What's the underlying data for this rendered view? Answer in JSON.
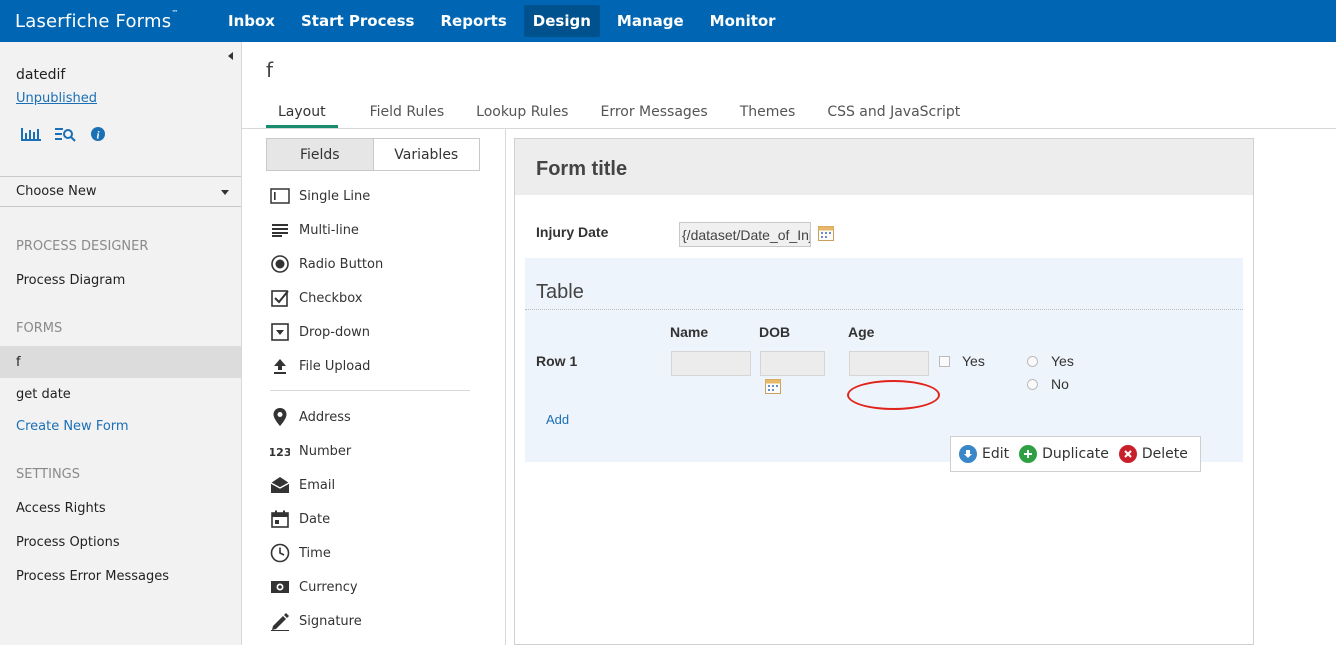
{
  "app": {
    "brand": "Laserfiche Forms",
    "brand_tm": "™",
    "nav": [
      {
        "label": "Inbox"
      },
      {
        "label": "Start Process"
      },
      {
        "label": "Reports"
      },
      {
        "label": "Design",
        "active": true
      },
      {
        "label": "Manage"
      },
      {
        "label": "Monitor"
      }
    ],
    "brand_color": "#0066b3"
  },
  "sidebar": {
    "process_name": "datedif",
    "status_link": "Unpublished",
    "icons": [
      "report-chart-icon",
      "search-list-icon",
      "info-icon"
    ],
    "choose_new": "Choose New",
    "sections": {
      "process_designer": {
        "heading": "PROCESS DESIGNER",
        "items": [
          "Process Diagram"
        ]
      },
      "forms": {
        "heading": "FORMS",
        "items": [
          "f",
          "get date"
        ],
        "selected": "f",
        "create_link": "Create New Form"
      },
      "settings": {
        "heading": "SETTINGS",
        "items": [
          "Access Rights",
          "Process Options",
          "Process Error Messages"
        ]
      }
    }
  },
  "main": {
    "form_name": "f",
    "tabs": [
      "Layout",
      "Field Rules",
      "Lookup Rules",
      "Error Messages",
      "Themes",
      "CSS and JavaScript"
    ],
    "active_tab": "Layout"
  },
  "toolbox": {
    "toggle": [
      "Fields",
      "Variables"
    ],
    "active_toggle": "Fields",
    "basic_fields": [
      {
        "label": "Single Line",
        "icon": "single-line-icon"
      },
      {
        "label": "Multi-line",
        "icon": "multi-line-icon"
      },
      {
        "label": "Radio Button",
        "icon": "radio-button-icon"
      },
      {
        "label": "Checkbox",
        "icon": "checkbox-icon"
      },
      {
        "label": "Drop-down",
        "icon": "dropdown-icon"
      },
      {
        "label": "File Upload",
        "icon": "file-upload-icon"
      }
    ],
    "advanced_fields": [
      {
        "label": "Address",
        "icon": "map-pin-icon"
      },
      {
        "label": "Number",
        "icon": "number-icon"
      },
      {
        "label": "Email",
        "icon": "email-icon"
      },
      {
        "label": "Date",
        "icon": "calendar-icon"
      },
      {
        "label": "Time",
        "icon": "clock-icon"
      },
      {
        "label": "Currency",
        "icon": "currency-icon"
      },
      {
        "label": "Signature",
        "icon": "pen-icon"
      }
    ]
  },
  "canvas": {
    "form_title": "Form title",
    "injury_date": {
      "label": "Injury Date",
      "value": "{/dataset/Date_of_Inj"
    },
    "table": {
      "title": "Table",
      "columns": [
        "Name",
        "DOB",
        "Age"
      ],
      "row_label": "Row 1",
      "checkbox_label": "Yes",
      "radio_options": [
        "Yes",
        "No"
      ],
      "add_label": "Add"
    },
    "actions": [
      {
        "label": "Edit",
        "color": "#3a87c8"
      },
      {
        "label": "Duplicate",
        "color": "#2ea043"
      },
      {
        "label": "Delete",
        "color": "#c8202a"
      }
    ]
  }
}
